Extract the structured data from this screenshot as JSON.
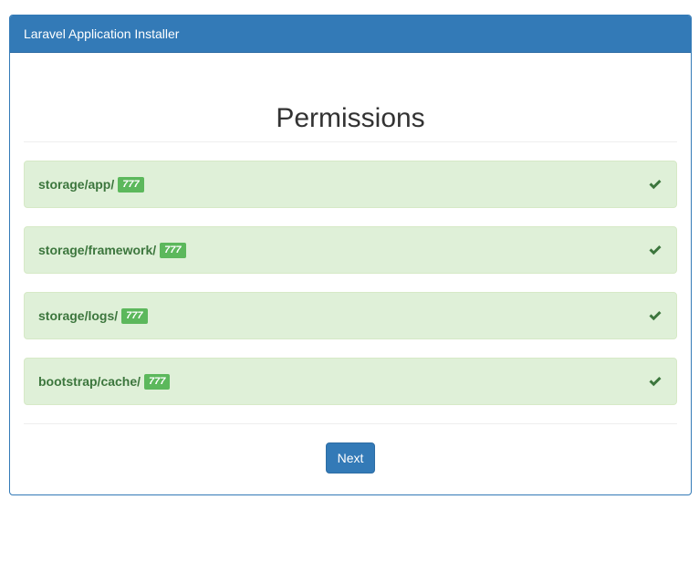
{
  "panel": {
    "heading": "Laravel Application Installer"
  },
  "page": {
    "title": "Permissions"
  },
  "permissions": [
    {
      "folder": "storage/app/",
      "mode": "777",
      "status_icon": "check-icon"
    },
    {
      "folder": "storage/framework/",
      "mode": "777",
      "status_icon": "check-icon"
    },
    {
      "folder": "storage/logs/",
      "mode": "777",
      "status_icon": "check-icon"
    },
    {
      "folder": "bootstrap/cache/",
      "mode": "777",
      "status_icon": "check-icon"
    }
  ],
  "actions": {
    "next_label": "Next"
  },
  "colors": {
    "primary": "#337ab7",
    "success_bg": "#dff0d8",
    "success_text": "#3c763d",
    "badge": "#5cb85c"
  }
}
